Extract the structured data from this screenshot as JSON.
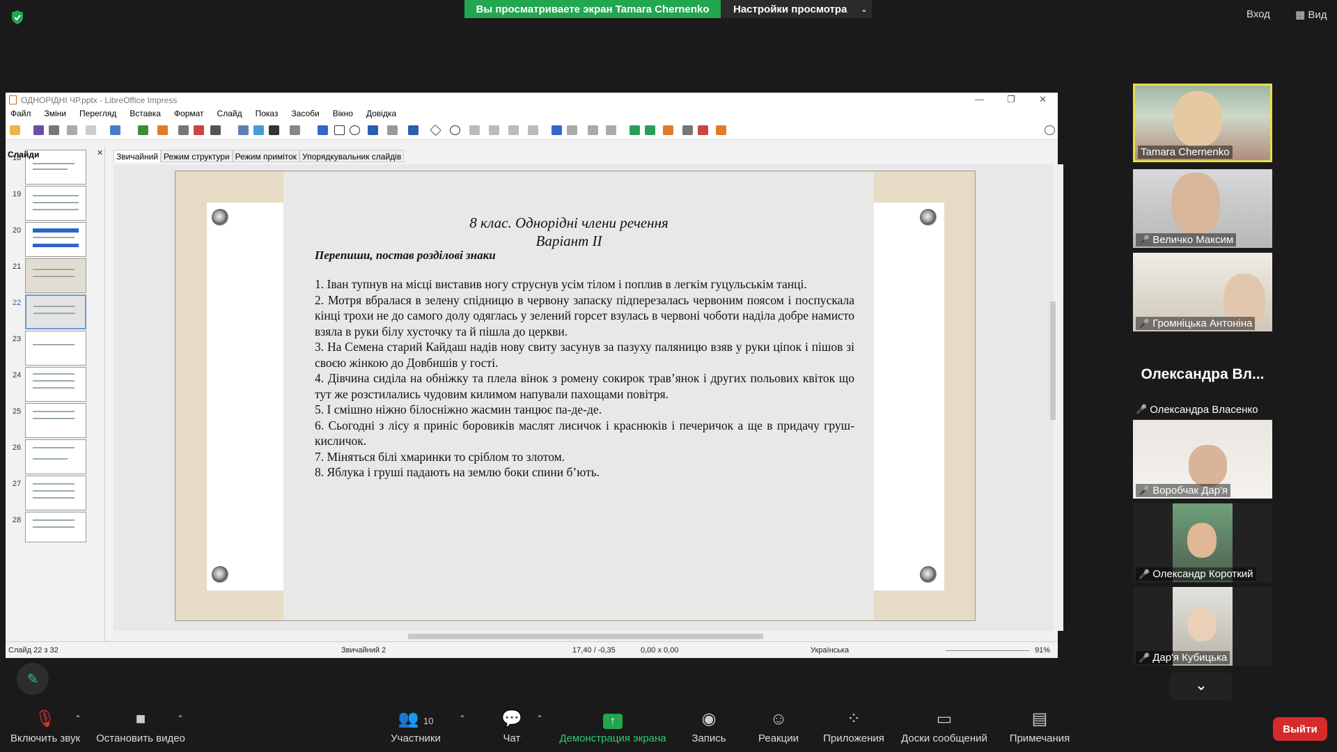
{
  "zoom_bar": {
    "share_banner": "Вы просматриваете экран Tamara Chernenko",
    "view_settings": "Настройки просмотра",
    "enter": "Вход",
    "view": "Вид"
  },
  "libreoffice": {
    "title": "ОДНОРІДНІ ЧР.pptx - LibreOffice Impress",
    "menu": [
      "Файл",
      "Зміни",
      "Перегляд",
      "Вставка",
      "Формат",
      "Слайд",
      "Показ",
      "Засоби",
      "Вікно",
      "Довідка"
    ],
    "slides_panel_title": "Слайди",
    "thumb_numbers": [
      "18",
      "19",
      "20",
      "21",
      "22",
      "23",
      "24",
      "25",
      "26",
      "27",
      "28"
    ],
    "selected_slide": "22",
    "view_tabs": [
      "Звичайний",
      "Режим структури",
      "Режим приміток",
      "Упорядкувальник слайдів"
    ],
    "status": {
      "slide": "Слайд 22 з 32",
      "layout": "Звичайний 2",
      "position": "17,40 / -0,35",
      "size": "0,00 x 0,00",
      "language": "Українська",
      "zoom": "91%"
    }
  },
  "slide_photo": {
    "title_line1": "8 клас. Однорідні члени речення",
    "title_line2": "Варіант ІІ",
    "task": "Перепиши, постав розділові знаки",
    "items": [
      "1. Іван тупнув на місці виставив ногу струснув усім тілом і поплив в легкім гуцульськім танці.",
      "2. Мотря вбралася в зелену спідницю в червону запаску підперезалась червоним поясом і поспускала кінці трохи не до самого долу одяглась у зелений горсет взулась в червоні чоботи наділа добре намисто взяла в руки білу хусточку та й пішла до церкви.",
      "3. На Семена старий Кайдаш надів нову свиту засунув за пазуху паляницю взяв у руки ціпок і пішов зі своєю жінкою до Довбишів у гості.",
      "4. Дівчина сиділа на обніжку та плела вінок з ромену сокирок трав’янок і других польових квіток що тут же розстилались чудовим килимом напували пахощами повітря.",
      "5. І смішно ніжно білосніжно жасмин танцює па-де-де.",
      "6. Сьогодні з лісу я приніс боровиків маслят лисичок і краснюків і печеричок а ще в придачу груш-кисличок.",
      "7. Міняться білі хмаринки то сріблом то злотом.",
      "8. Яблука і груші падають на землю боки спини б’ють."
    ]
  },
  "participants": [
    {
      "name": "Tamara Chernenko",
      "muted": false,
      "active": true
    },
    {
      "name": "Величко Максим",
      "muted": true
    },
    {
      "name": "Громніцька Антоніна",
      "muted": true
    },
    {
      "name": "Олександра Власенко",
      "muted": true,
      "big_name": "Олександра Вл..."
    },
    {
      "name": "Воробчак Дар'я",
      "muted": true
    },
    {
      "name": "Олександр Короткий",
      "muted": true
    },
    {
      "name": "Дар'я Кубицька",
      "muted": true
    }
  ],
  "bottom_bar": {
    "unmute": "Включить звук",
    "stop_video": "Остановить видео",
    "participants": "Участники",
    "participants_count": "10",
    "chat": "Чат",
    "share": "Демонстрация экрана",
    "record": "Запись",
    "reactions": "Реакции",
    "apps": "Приложения",
    "whiteboards": "Доски сообщений",
    "notes": "Примечания",
    "leave": "Выйти"
  },
  "colors": {
    "share_green": "#22a650",
    "leave_red": "#d42b2b",
    "active_speaker": "#e5e044"
  }
}
